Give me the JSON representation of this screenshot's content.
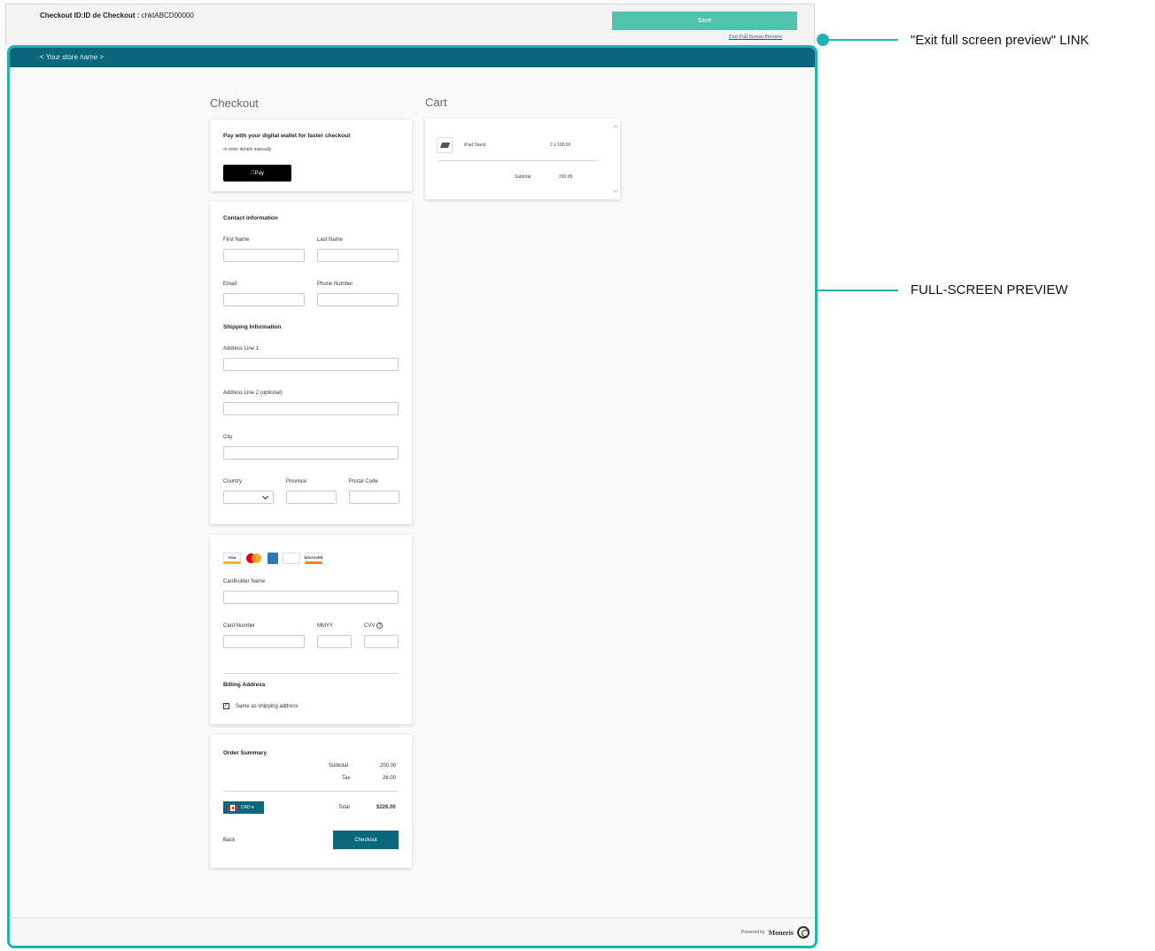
{
  "header": {
    "title_label": "Checkout ID:ID de Checkout : ",
    "checkout_id": "chktABCD00000",
    "save_label": "Save",
    "exit_link": "Exit Full Screen Preview"
  },
  "store": {
    "name": "< Your store name >"
  },
  "checkout": {
    "heading": "Checkout",
    "wallet": {
      "title": "Pay with your digital wallet for faster checkout",
      "subtitle": "or enter details manually",
      "applepay_label": "Pay"
    },
    "contact": {
      "heading": "Contact information",
      "first_name": "First Name",
      "last_name": "Last Name",
      "email": "Email",
      "phone": "Phone Number"
    },
    "shipping": {
      "heading": "Shipping Information",
      "address1": "Address Line 1",
      "address2": "Address Line 2 (optional)",
      "city": "City",
      "country": "Country",
      "province": "Province",
      "postal": "Postal Code"
    },
    "payment": {
      "card_brands": [
        "VISA",
        "mastercard",
        "AMEX",
        "Diners Club",
        "DISCOVER"
      ],
      "cardholder": "Cardholder Name",
      "card_number": "Card Number",
      "mmyy": "MMYY",
      "cvv": "CVV",
      "cvv_help": "?",
      "billing_heading": "Billing Address",
      "same_as_shipping": "Same as shipping address",
      "same_as_shipping_checked": true,
      "check_mark": "✓"
    },
    "summary": {
      "heading": "Order Summary",
      "subtotal_label": "Subtotal",
      "subtotal": "200.00",
      "tax_label": "Tax",
      "tax": "26.00",
      "currency": "CAD ▾",
      "total_label": "Total",
      "total": "$226.00",
      "back": "Back",
      "checkout_button": "Checkout"
    }
  },
  "cart": {
    "heading": "Cart",
    "items": [
      {
        "name": "iPad Stand",
        "qty_price": "2 x 100.00"
      }
    ],
    "subtotal_label": "Subtotal",
    "subtotal": "200.00"
  },
  "footer": {
    "powered_by": "Powered by",
    "brand": "Moneris"
  },
  "callouts": {
    "exit_link": "\"Exit full screen preview\" LINK",
    "full_screen": "FULL-SCREEN PREVIEW"
  },
  "colors": {
    "accent": "#1fb2b8",
    "brand": "#0a667a",
    "save": "#4ec3ad"
  }
}
